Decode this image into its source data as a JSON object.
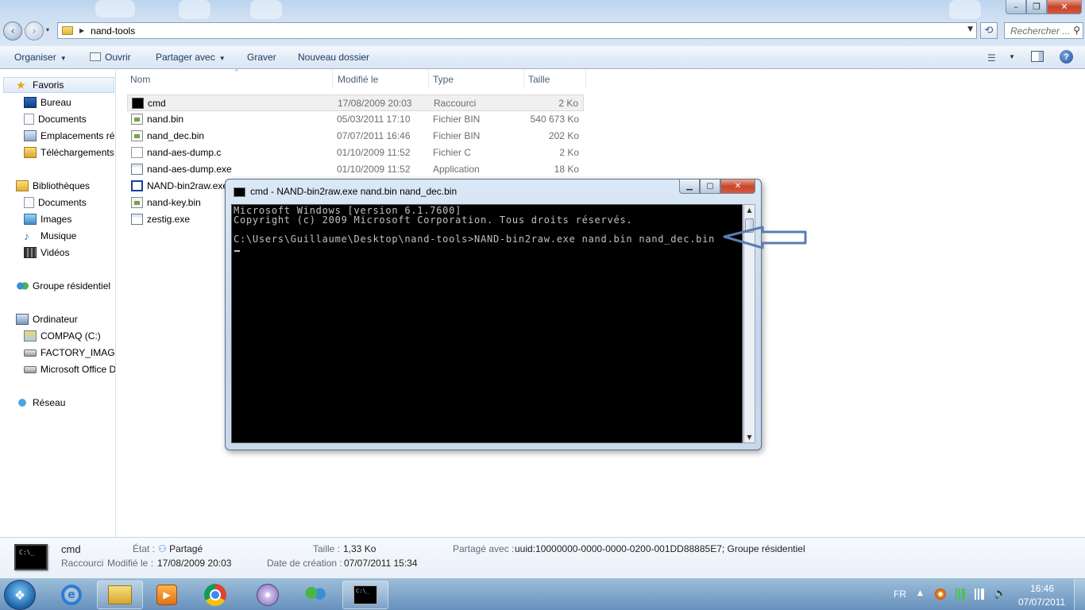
{
  "window": {
    "controls": {
      "minimize": "–",
      "maximize": "❐",
      "close": "✕"
    }
  },
  "address": {
    "back": "‹",
    "forward": "›",
    "dropdown": "▾",
    "crumb_arrow": "▶",
    "path": "nand-tools",
    "refresh": "⟲",
    "search_placeholder": "Rechercher ...",
    "search_icon": "⚲"
  },
  "toolbar": {
    "organize": "Organiser",
    "open": "Ouvrir",
    "share": "Partager avec",
    "burn": "Graver",
    "new_folder": "Nouveau dossier",
    "dropdown_arrow": "▼",
    "view_icon": "☰",
    "help": "?"
  },
  "sidebar": {
    "favorites": {
      "label": "Favoris",
      "items": [
        "Bureau",
        "Documents",
        "Emplacements ré",
        "Téléchargements"
      ]
    },
    "libraries": {
      "label": "Bibliothèques",
      "items": [
        "Documents",
        "Images",
        "Musique",
        "Vidéos"
      ]
    },
    "homegroup": "Groupe résidentiel",
    "computer": {
      "label": "Ordinateur",
      "items": [
        "COMPAQ (C:)",
        "FACTORY_IMAGE",
        "Microsoft Office D"
      ]
    },
    "network": "Réseau"
  },
  "columns": {
    "name": "Nom",
    "date": "Modifié le",
    "type": "Type",
    "size": "Taille",
    "sort_indicator": "^"
  },
  "files": [
    {
      "name": "cmd",
      "date": "17/08/2009 20:03",
      "type": "Raccourci",
      "size": "2 Ko",
      "icon": "cmd-icon"
    },
    {
      "name": "nand.bin",
      "date": "05/03/2011 17:10",
      "type": "Fichier BIN",
      "size": "540 673 Ko",
      "icon": "bin-file-icon"
    },
    {
      "name": "nand_dec.bin",
      "date": "07/07/2011 16:46",
      "type": "Fichier BIN",
      "size": "202 Ko",
      "icon": "bin-file-icon"
    },
    {
      "name": "nand-aes-dump.c",
      "date": "01/10/2009 11:52",
      "type": "Fichier C",
      "size": "2 Ko",
      "icon": "c-file-icon"
    },
    {
      "name": "nand-aes-dump.exe",
      "date": "01/10/2009 11:52",
      "type": "Application",
      "size": "18 Ko",
      "icon": "exe-icon"
    },
    {
      "name": "NAND-bin2raw.exe",
      "date": "",
      "type": "",
      "size": "",
      "icon": "exe-icon"
    },
    {
      "name": "nand-key.bin",
      "date": "",
      "type": "",
      "size": "",
      "icon": "bin-file-icon"
    },
    {
      "name": "zestig.exe",
      "date": "",
      "type": "",
      "size": "",
      "icon": "exe-icon"
    }
  ],
  "cmd_window": {
    "title": "cmd - NAND-bin2raw.exe  nand.bin nand_dec.bin",
    "min": "▁",
    "max": "▢",
    "close": "✕",
    "console_text": "Microsoft Windows [version 6.1.7600]\nCopyright (c) 2009 Microsoft Corporation. Tous droits réservés.\n\nC:\\Users\\Guillaume\\Desktop\\nand-tools>NAND-bin2raw.exe nand.bin nand_dec.bin",
    "scroll_up": "▲",
    "scroll_down": "▼"
  },
  "annotation": {
    "arrow_color": "#5b7db0"
  },
  "details": {
    "thumb_text": "C:\\_",
    "name": "cmd",
    "type": "Raccourci",
    "state_label": "État :",
    "state_value": "Partagé",
    "modified_label": "Modifié le :",
    "modified_value": "17/08/2009 20:03",
    "size_label": "Taille :",
    "size_value": "1,33 Ko",
    "created_label": "Date de création :",
    "created_value": "07/07/2011 15:34",
    "shared_label": "Partagé avec :",
    "shared_value": "uuid:10000000-0000-0000-0200-001DD88885E7; Groupe résidentiel"
  },
  "taskbar": {
    "start_glyph": "❖",
    "ie_glyph": "e",
    "media_glyph": "▶",
    "cmd_glyph": "C:\\_",
    "lang": "FR",
    "tray_up": "▲",
    "time": "16:46",
    "date": "07/07/2011"
  }
}
